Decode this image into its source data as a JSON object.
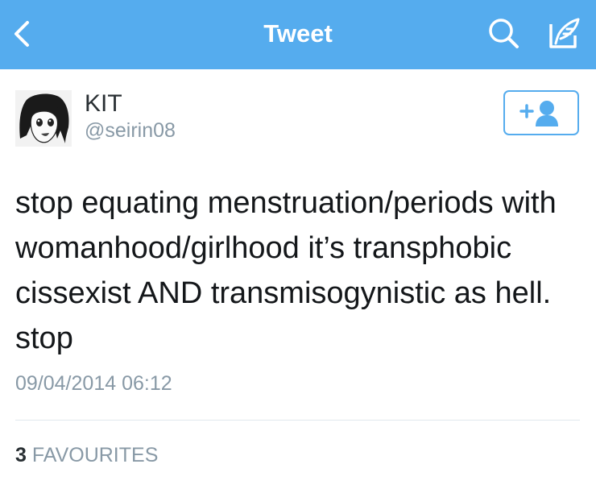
{
  "navbar": {
    "title": "Tweet",
    "background_color": "#55acee",
    "back_icon": "chevron-left-icon",
    "search_icon": "search-icon",
    "compose_icon": "compose-tweet-icon"
  },
  "author": {
    "display_name": "KIT",
    "handle": "@seirin08",
    "avatar": "anime-character-avatar"
  },
  "follow_button": {
    "icon": "follow-user-icon",
    "color": "#55acee"
  },
  "tweet": {
    "text": "stop equating menstruation/periods with womanhood/girlhood it’s transphobic cissexist AND transmisogynistic as hell. stop",
    "timestamp": "09/04/2014 06:12"
  },
  "stats": {
    "favourites_count": "3",
    "favourites_label": "FAVOURITES"
  }
}
